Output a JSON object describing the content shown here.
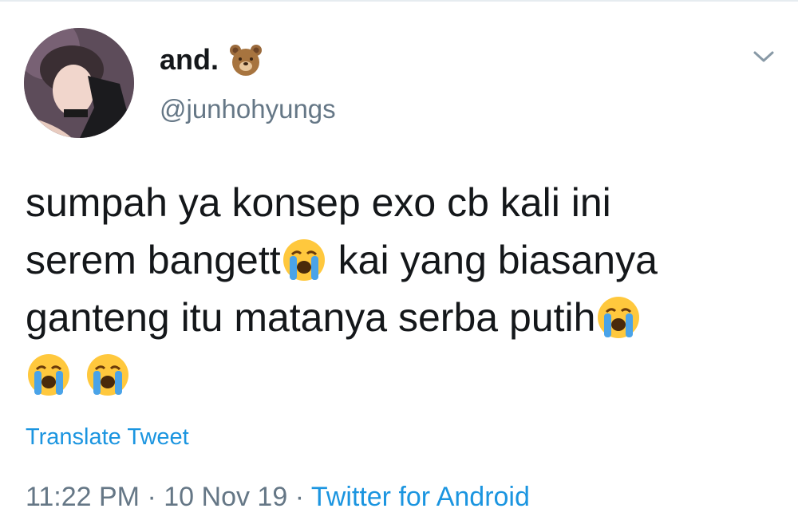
{
  "tweet": {
    "author": {
      "display_name": "and.",
      "name_emoji": "bear-face-icon",
      "handle": "@junhohyungs"
    },
    "text_lines": [
      "sumpah ya konsep exo cb kali ini",
      "serem bangett",
      "kai yang biasanya",
      "ganteng itu matanya serba putih"
    ],
    "emoji": "loudly-crying-face-icon",
    "translate_label": "Translate Tweet",
    "time": "11:22 PM",
    "date": "10 Nov 19",
    "separator": "·",
    "source": "Twitter for Android"
  },
  "colors": {
    "text": "#14171a",
    "secondary": "#657786",
    "link": "#1b95e0"
  }
}
